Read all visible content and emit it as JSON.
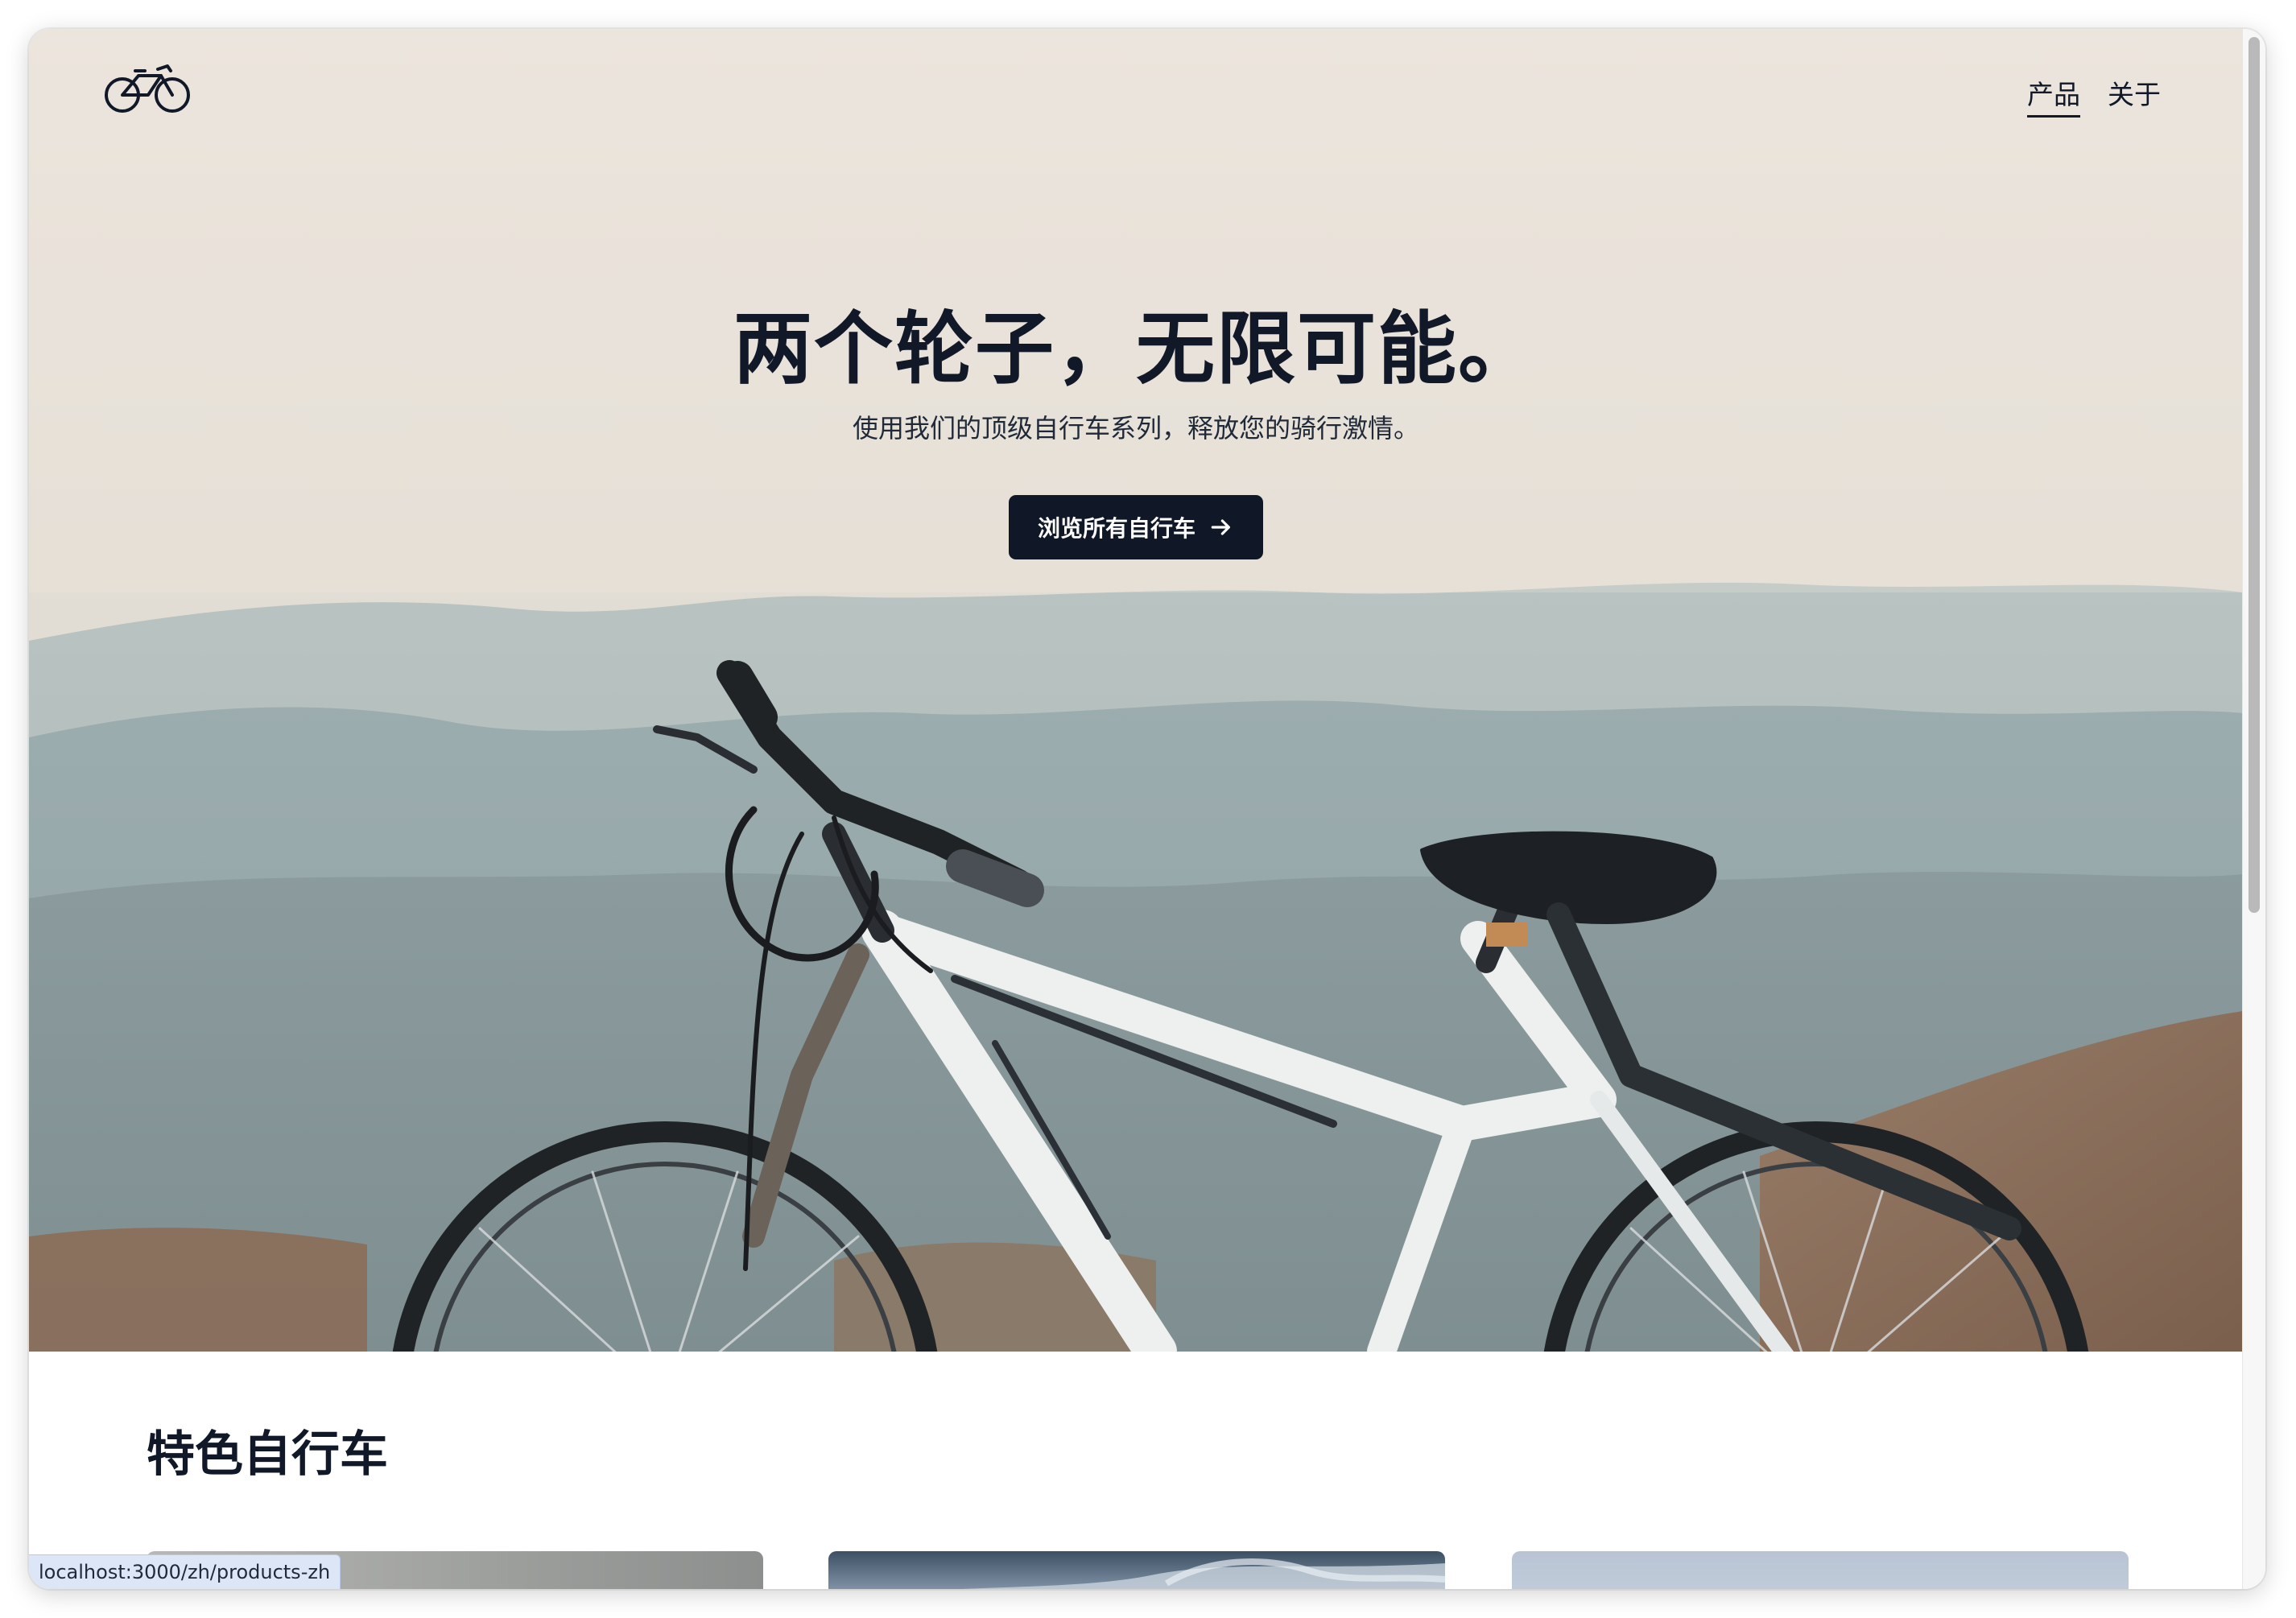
{
  "nav": {
    "items": [
      {
        "label": "产品",
        "active": true
      },
      {
        "label": "关于",
        "active": false
      }
    ]
  },
  "logo": {
    "icon": "bicycle-icon"
  },
  "hero": {
    "title": "两个轮子，无限可能。",
    "subtitle": "使用我们的顶级自行车系列，释放您的骑行激情。",
    "cta_label": "浏览所有自行车",
    "cta_icon": "arrow-right-icon"
  },
  "featured": {
    "title": "特色自行车"
  },
  "status_bar": {
    "url": "localhost:3000/zh/products-zh"
  },
  "colors": {
    "text_primary": "#111827",
    "button_bg": "#101828",
    "button_text": "#ffffff",
    "status_bar_bg": "#dde6f6"
  }
}
